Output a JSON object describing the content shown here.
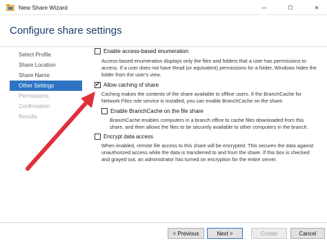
{
  "window": {
    "title": "New Share Wizard",
    "minimize_glyph": "—",
    "maximize_glyph": "☐",
    "close_glyph": "✕"
  },
  "page_title": "Configure share settings",
  "nav": {
    "items": [
      {
        "label": "Select Profile",
        "state": "normal"
      },
      {
        "label": "Share Location",
        "state": "normal"
      },
      {
        "label": "Share Name",
        "state": "normal"
      },
      {
        "label": "Other Settings",
        "state": "active"
      },
      {
        "label": "Permissions",
        "state": "disabled"
      },
      {
        "label": "Confirmation",
        "state": "disabled"
      },
      {
        "label": "Results",
        "state": "disabled"
      }
    ]
  },
  "options": {
    "abe": {
      "label": "Enable access-based enumeration",
      "checked": false,
      "desc": [
        "Access-based enumeration displays only the files and folders that a user has permissions to",
        "access. If a user does not have Read (or equivalent) permissions for a folder, Windows hides the",
        "folder from the user's view."
      ]
    },
    "caching": {
      "label": "Allow caching of share",
      "checked": true,
      "desc": [
        "Caching makes the contents of the share available to offline users. If the BranchCache for",
        "Network Files role service is installed, you can enable BranchCache on the share."
      ]
    },
    "branchcache": {
      "label": "Enable BranchCache on the file share",
      "checked": false,
      "desc": [
        "BranchCache enables computers in a branch office to cache files downloaded from this",
        "share, and then allows the files to be securely available to other computers in the branch."
      ]
    },
    "encrypt": {
      "label": "Encrypt data access",
      "checked": false,
      "desc": [
        "When enabled, remote file access to this share will be encrypted. This secures the data against",
        "unauthorized access while the data is transferred to and from the share. If this box is checked",
        "and grayed out, an administrator has turned on encryption for the entire server."
      ]
    }
  },
  "buttons": {
    "previous": "< Previous",
    "next": "Next >",
    "create": "Create",
    "cancel": "Cancel"
  },
  "colors": {
    "accent": "#2f74c2",
    "title": "#1b3a67",
    "annotation_arrow": "#e0303c"
  }
}
